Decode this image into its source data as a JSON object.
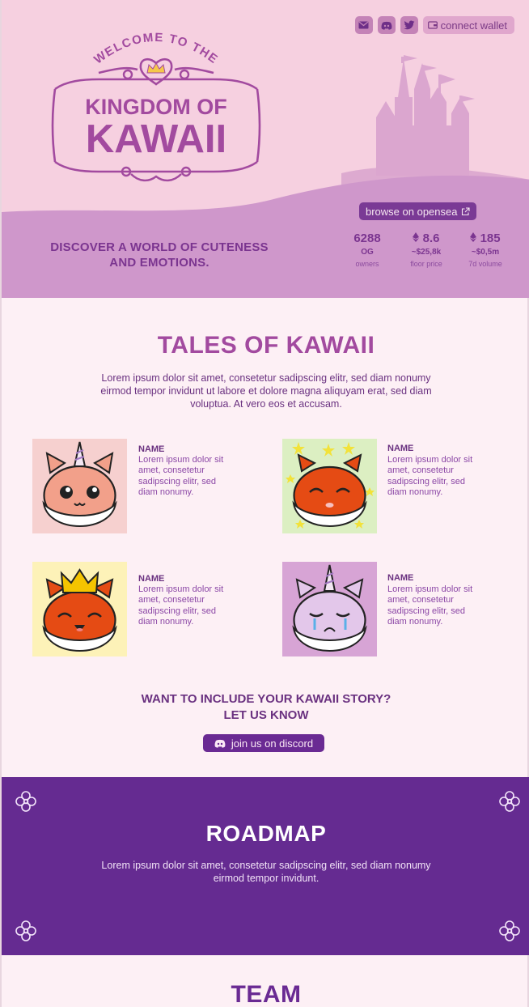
{
  "header": {
    "connect_wallet_label": "connect wallet",
    "icons": [
      "mail-icon",
      "discord-icon",
      "twitter-icon",
      "wallet-icon"
    ]
  },
  "logo": {
    "welcome": "WELCOME TO THE",
    "line1": "KINGDOM OF",
    "line2": "KAWAII"
  },
  "hero": {
    "tagline": "DISCOVER A WORLD OF CUTENESS AND EMOTIONS.",
    "opensea_label": "browse on opensea",
    "stats": [
      {
        "value": "6288",
        "sub": "OG",
        "label": "owners"
      },
      {
        "value": "8.6",
        "sub": "~$25,8k",
        "label": "floor price",
        "eth": true
      },
      {
        "value": "185",
        "sub": "~$0,5m",
        "label": "7d volume",
        "eth": true
      }
    ]
  },
  "tales": {
    "title": "TALES OF KAWAII",
    "description": "Lorem ipsum dolor sit amet, consetetur sadipscing elitr, sed diam nonumy eirmod tempor invidunt ut labore et dolore magna aliquyam erat, sed diam voluptua. At vero eos et accusam.",
    "cards": [
      {
        "name": "NAME",
        "text": "Lorem ipsum dolor sit amet, consetetur sadipscing elitr, sed diam nonumy.",
        "bg": "#f6d0cf"
      },
      {
        "name": "NAME",
        "text": "Lorem ipsum dolor sit amet, consetetur sadipscing elitr, sed diam nonumy.",
        "bg": "#dcefc2"
      },
      {
        "name": "NAME",
        "text": "Lorem ipsum dolor sit amet, consetetur sadipscing elitr, sed diam nonumy.",
        "bg": "#fdf2b8"
      },
      {
        "name": "NAME",
        "text": "Lorem ipsum dolor sit amet, consetetur sadipscing elitr, sed diam nonumy.",
        "bg": "#d7a4d5"
      }
    ],
    "cta_line1": "WANT TO INCLUDE YOUR KAWAII STORY?",
    "cta_line2": "LET US KNOW",
    "discord_label": "join us on discord"
  },
  "roadmap": {
    "title": "ROADMAP",
    "description": "Lorem ipsum dolor sit amet, consetetur sadipscing elitr, sed diam nonumy eirmod tempor invidunt."
  },
  "team": {
    "title": "TEAM"
  },
  "colors": {
    "hero_bg": "#f6d0e0",
    "hero_hill": "#cf97cb",
    "primary": "#6a2a93",
    "accent": "#a24a9f",
    "roadmap_bg": "#652b91"
  }
}
